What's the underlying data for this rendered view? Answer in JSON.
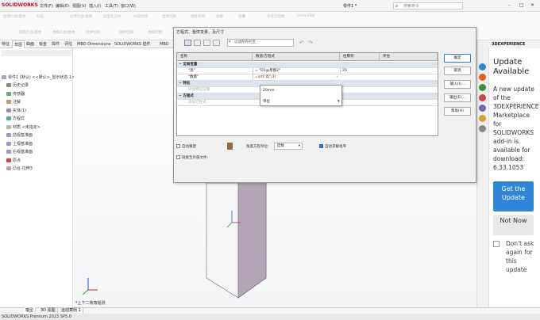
{
  "app": {
    "logo": "SOLIDWORKS",
    "doc_title": "零件1 *",
    "search_placeholder": "搜索命令"
  },
  "menu": [
    "文件(F)",
    "编辑(E)",
    "视图(V)",
    "插入(I)",
    "工具(T)",
    "窗口(W)"
  ],
  "ribbon": {
    "groups": [
      "拉伸凸台/基体",
      "旋转凸台/基体",
      "扫描",
      "放样凸台/基体",
      "边界凸台/基体",
      "拉伸切除",
      "异型孔向导",
      "旋转切除",
      "扫描切除",
      "放样切割",
      "边界切除",
      "圆角",
      "线性阵列",
      "筋",
      "拔模",
      "抽壳",
      "包覆",
      "相交",
      "参考几何体",
      "曲线",
      "Instant3D"
    ]
  },
  "tabs": [
    "特征",
    "草图",
    "曲面",
    "钣金",
    "焊件",
    "评估",
    "MBD Dimensions",
    "SOLIDWORKS 插件",
    "MBD"
  ],
  "tree": {
    "root": "零件1 (默认) <<默认>_显示状态 1>",
    "items": [
      "历史记录",
      "传感器",
      "注解",
      "实体(1)",
      "方程式",
      "材质 <未指定>",
      "前视基准面",
      "上视基准面",
      "右视基准面",
      "原点",
      "凸台-拉伸3"
    ]
  },
  "dialog": {
    "title": "方程式、整体变量、及尺寸",
    "filter_placeholder": "过滤所有栏区",
    "headers": [
      "名称",
      "数值/方程式",
      "估算到",
      "评估"
    ],
    "sections": {
      "globals": "全局变量",
      "features": "特征",
      "equations": "方程式"
    },
    "rows": {
      "g1_name": "\"高\"",
      "g1_value": "= \"D1@草图2\"",
      "g1_eval": "20",
      "g2_name": "\"数量\"",
      "g2_value": "=int(\"高\"/3)",
      "feat_add": "添加特征压缩",
      "eq_add": "添加方程式"
    },
    "popup": [
      "20mm",
      "单位"
    ],
    "buttons": [
      "确定",
      "取消",
      "输入(I)...",
      "输出(E)...",
      "帮助(H)"
    ],
    "options": {
      "auto_rebuild": "自动重建",
      "angle_unit_label": "角度方程单位:",
      "angle_unit_value": "度数",
      "auto_solve": "自动求解组序",
      "link_file": "链接至外部文件:"
    }
  },
  "taskpane": {
    "header": "3DEXPERIENCE",
    "title": "Update Available",
    "body": "A new update of the 3DEXPERIENCE Marketplace for SOLIDWORKS add-in is available for download: 6.33.1053",
    "get_btn": "Get the Update",
    "not_now_btn": "Not Now",
    "dont_ask": "Don't ask again for this update"
  },
  "view_label": "*上下二等角轴测",
  "bottom_tabs": [
    "模型",
    "3D 视图",
    "运动算例 1"
  ],
  "status": "SOLIDWORKS Premium 2023 SP5.0",
  "colors": {
    "accent": "#2f86d6",
    "brand": "#c8102e",
    "body_side": "#b3a5b5"
  }
}
